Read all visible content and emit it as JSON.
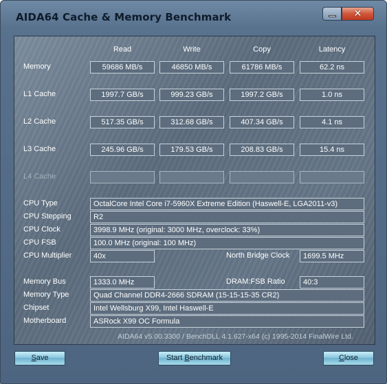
{
  "window": {
    "title": "AIDA64 Cache & Memory Benchmark"
  },
  "columns": [
    "Read",
    "Write",
    "Copy",
    "Latency"
  ],
  "benchmark_rows": [
    {
      "label": "Memory",
      "values": [
        "59686 MB/s",
        "46850 MB/s",
        "61786 MB/s",
        "62.2 ns"
      ]
    },
    {
      "label": "L1 Cache",
      "values": [
        "1997.7 GB/s",
        "999.23 GB/s",
        "1997.2 GB/s",
        "1.0 ns"
      ]
    },
    {
      "label": "L2 Cache",
      "values": [
        "517.35 GB/s",
        "312.68 GB/s",
        "407.34 GB/s",
        "4.1 ns"
      ]
    },
    {
      "label": "L3 Cache",
      "values": [
        "245.96 GB/s",
        "179.53 GB/s",
        "208.83 GB/s",
        "15.4 ns"
      ]
    },
    {
      "label": "L4 Cache",
      "values": [
        "",
        "",
        "",
        ""
      ]
    }
  ],
  "cpu": {
    "type_label": "CPU Type",
    "type_value": "OctalCore Intel Core i7-5960X Extreme Edition  (Haswell-E, LGA2011-v3)",
    "stepping_label": "CPU Stepping",
    "stepping_value": "R2",
    "clock_label": "CPU Clock",
    "clock_value": "3998.9 MHz  (original: 3000 MHz, overclock: 33%)",
    "fsb_label": "CPU FSB",
    "fsb_value": "100.0 MHz  (original: 100 MHz)",
    "multiplier_label": "CPU Multiplier",
    "multiplier_value": "40x",
    "nb_clock_label": "North Bridge Clock",
    "nb_clock_value": "1699.5 MHz"
  },
  "memory": {
    "bus_label": "Memory Bus",
    "bus_value": "1333.0 MHz",
    "ratio_label": "DRAM:FSB Ratio",
    "ratio_value": "40:3",
    "type_label": "Memory Type",
    "type_value": "Quad Channel DDR4-2666 SDRAM  (15-15-15-35 CR2)",
    "chipset_label": "Chipset",
    "chipset_value": "Intel Wellsburg X99, Intel Haswell-E",
    "motherboard_label": "Motherboard",
    "motherboard_value": "ASRock X99 OC Formula"
  },
  "footer": "AIDA64 v5.00.3300 / BenchDLL 4.1.627-x64  (c) 1995-2014 FinalWire Ltd.",
  "buttons": {
    "save_mnemonic": "S",
    "save_rest": "ave",
    "start_prefix": "Start ",
    "start_mnemonic": "B",
    "start_rest": "enchmark",
    "close_mnemonic": "C",
    "close_rest": "lose"
  },
  "icons": {
    "minimize": "minimize-icon",
    "close": "close-icon"
  },
  "colors": {
    "titlebar": "#58718d",
    "panel": "#5c6c7d",
    "close_button": "#c0391f",
    "action_button": "#8cc8df"
  }
}
